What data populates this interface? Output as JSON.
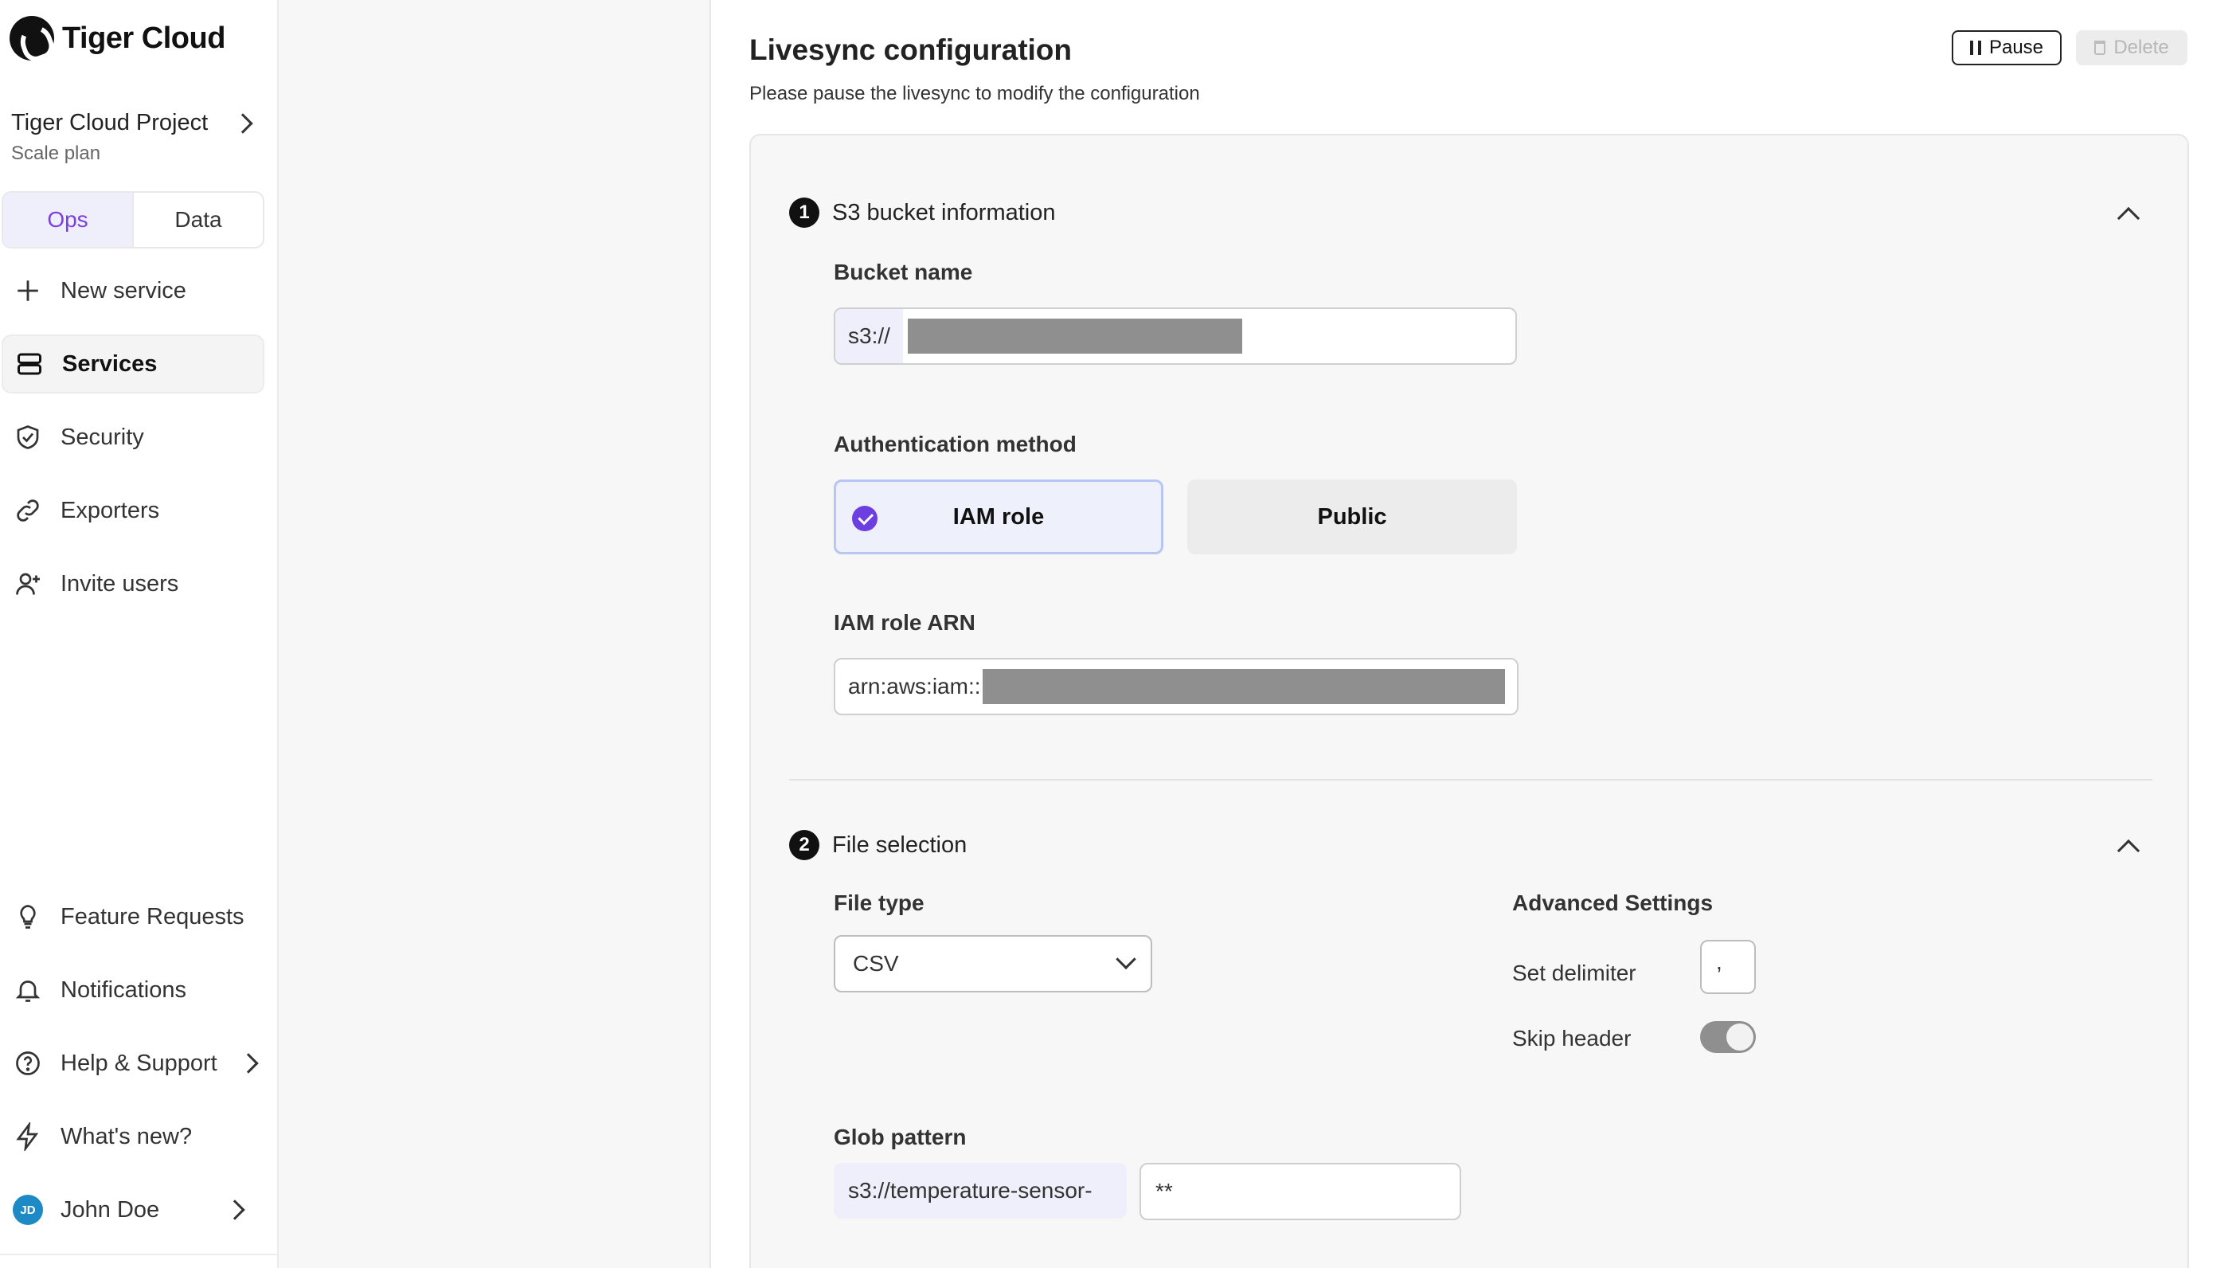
{
  "brand": {
    "name": "Tiger Cloud"
  },
  "project": {
    "name": "Tiger Cloud Project",
    "plan": "Scale plan"
  },
  "segment": {
    "ops": "Ops",
    "data": "Data"
  },
  "nav": {
    "new_service": "New service",
    "services": "Services",
    "security": "Security",
    "exporters": "Exporters",
    "invite_users": "Invite users",
    "feature_requests": "Feature Requests",
    "notifications": "Notifications",
    "help_support": "Help & Support",
    "whats_new": "What's new?",
    "user_name": "John Doe",
    "user_initials": "JD"
  },
  "page": {
    "title": "Livesync configuration",
    "subtitle": "Please pause the livesync to modify the configuration",
    "pause_label": "Pause",
    "delete_label": "Delete"
  },
  "step1": {
    "number": "1",
    "title": "S3 bucket information",
    "bucket_label": "Bucket name",
    "bucket_prefix": "s3://",
    "auth_label": "Authentication method",
    "auth_options": [
      "IAM role",
      "Public"
    ],
    "auth_selected": "IAM role",
    "arn_label": "IAM role ARN",
    "arn_prefix": "arn:aws:iam::"
  },
  "step2": {
    "number": "2",
    "title": "File selection",
    "file_type_label": "File type",
    "file_type_value": "CSV",
    "advanced_label": "Advanced Settings",
    "delimiter_label": "Set delimiter",
    "delimiter_value": ",",
    "skip_header_label": "Skip header",
    "skip_header_on": true,
    "glob_label": "Glob pattern",
    "glob_prefix": "s3://temperature-sensor-",
    "glob_value": "**"
  },
  "colors": {
    "accent": "#7b3fe4",
    "selected_bg": "#eef0fb",
    "redaction": "#8f8f8f"
  }
}
